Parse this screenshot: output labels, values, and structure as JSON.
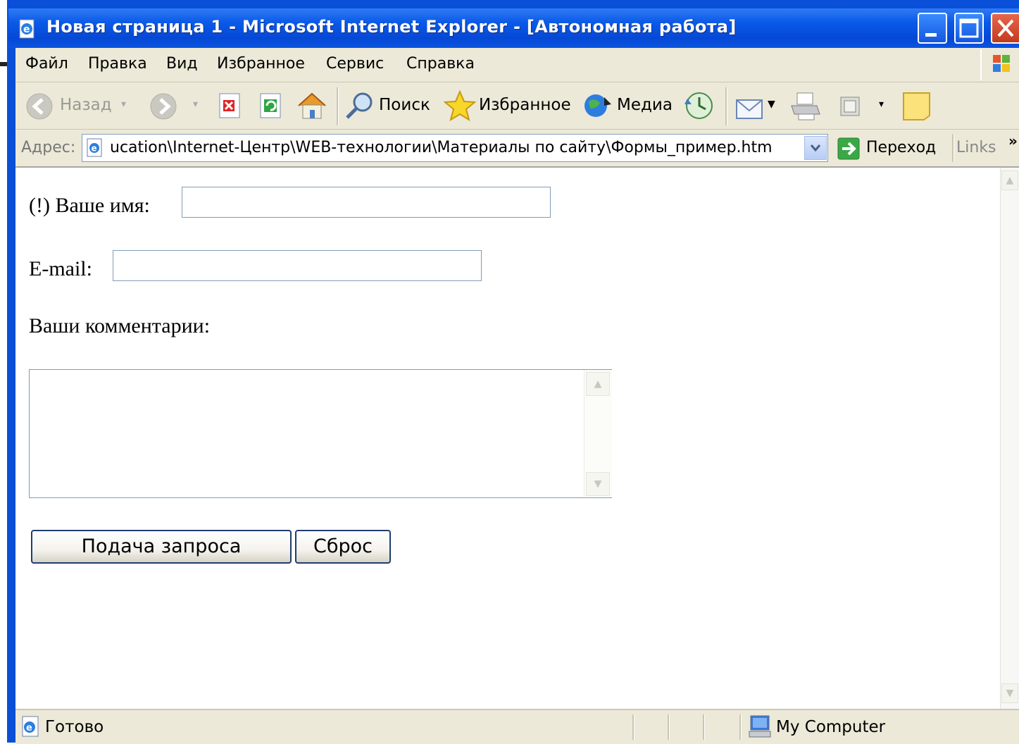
{
  "window": {
    "title": "Новая страница 1 - Microsoft Internet Explorer - [Автономная работа]"
  },
  "menu": {
    "items": [
      "Файл",
      "Правка",
      "Вид",
      "Избранное",
      "Сервис",
      "Справка"
    ]
  },
  "toolbar": {
    "back_label": "Назад",
    "search_label": "Поиск",
    "favorites_label": "Избранное",
    "media_label": "Медиа"
  },
  "address": {
    "label": "Адрес:",
    "value": "ucation\\Internet-Центр\\WEB-технологии\\Материалы по сайту\\Формы_пример.htm",
    "go_label": "Переход",
    "links_label": "Links",
    "overflow_label": "»"
  },
  "form": {
    "name_label": "(!) Ваше имя:",
    "name_value": "",
    "email_label": "E-mail:",
    "email_value": "",
    "comments_label": "Ваши комментарии:",
    "comments_value": "",
    "submit_label": "Подача запроса",
    "reset_label": "Сброс"
  },
  "status": {
    "text": "Готово",
    "zone": "My Computer"
  },
  "colors": {
    "titlebar": "#0548d6",
    "chrome": "#ece9d8",
    "input_border": "#7f9db9",
    "button_border": "#1f3d6f"
  },
  "icons": [
    "ie-page-icon",
    "minimize-icon",
    "maximize-icon",
    "close-icon",
    "windows-logo-icon",
    "back-arrow-icon",
    "forward-arrow-icon",
    "stop-icon",
    "refresh-icon",
    "home-icon",
    "search-icon",
    "favorites-star-icon",
    "media-icon",
    "history-icon",
    "mail-icon",
    "print-icon",
    "edit-icon",
    "messenger-icon",
    "address-page-icon",
    "dropdown-arrow-icon",
    "go-arrow-icon",
    "computer-icon"
  ]
}
